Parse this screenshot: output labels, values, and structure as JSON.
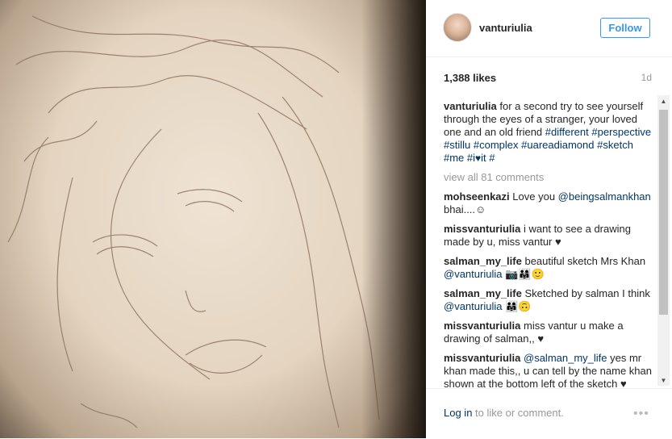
{
  "post": {
    "username": "vanturiulia",
    "follow_label": "Follow",
    "likes": "1,388 likes",
    "age": "1d"
  },
  "caption": {
    "user": "vanturiulia",
    "text": "for a second try to see yourself through the eyes of a stranger, your loved one and an old friend",
    "tags": [
      "#different",
      "#perspective",
      "#stillu",
      "#complex",
      "#uareadiamond",
      "#sketch",
      "#me",
      "#i",
      "it",
      "#"
    ]
  },
  "view_all": "view all 81 comments",
  "comments": [
    {
      "user": "mohseenkazi",
      "text": "Love you ",
      "mention": "@beingsalmankhan",
      "after": " bhai....☺"
    },
    {
      "user": "missvanturiulia",
      "text": "i want to see a drawing made by u, miss vantur ♥"
    },
    {
      "user": "salman_my_life",
      "text": "beautiful sketch Mrs Khan ",
      "mention": "@vanturiulia",
      "after": " 📷👨‍👩‍👧🙂"
    },
    {
      "user": "salman_my_life",
      "text": "Sketched by salman I think ",
      "mention": "@vanturiulia",
      "after": " 👨‍👩‍👧🙃"
    },
    {
      "user": "missvanturiulia",
      "text": "miss vantur u make a drawing of salman,, ♥"
    },
    {
      "user": "missvanturiulia",
      "text": "",
      "mention": "@salman_my_life",
      "after": " yes mr khan made this,, u can tell by the name khan shown at the bottom left of the sketch ♥"
    }
  ],
  "footer": {
    "login_link": "Log in",
    "login_rest": " to like or comment.",
    "more": "•••"
  }
}
